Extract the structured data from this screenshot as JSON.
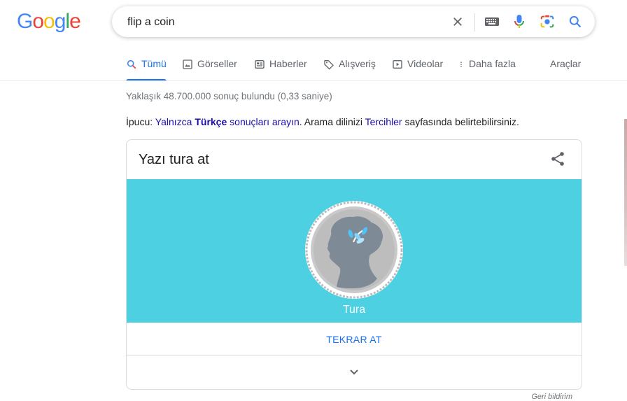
{
  "logo": {
    "letters": [
      "G",
      "o",
      "o",
      "g",
      "l",
      "e"
    ],
    "colors": [
      "#4285f4",
      "#ea4335",
      "#fbbc05",
      "#4285f4",
      "#34a853",
      "#ea4335"
    ]
  },
  "search": {
    "query": "flip a coin",
    "icons": [
      "clear-icon",
      "keyboard-icon",
      "microphone-icon",
      "camera-lens-icon",
      "search-icon"
    ]
  },
  "tabs": [
    {
      "label": "Tümü",
      "icon": "search-icon",
      "active": true
    },
    {
      "label": "Görseller",
      "icon": "image-icon"
    },
    {
      "label": "Haberler",
      "icon": "news-icon"
    },
    {
      "label": "Alışveriş",
      "icon": "tag-icon"
    },
    {
      "label": "Videolar",
      "icon": "play-icon"
    },
    {
      "label": "Daha fazla",
      "icon": "more-vert-icon"
    }
  ],
  "tools_label": "Araçlar",
  "stats": "Yaklaşık 48.700.000 sonuç bulundu (0,33 saniye)",
  "tip": {
    "prefix": "İpucu: ",
    "link1": "Yalnızca",
    "bold": "Türkçe",
    "link2": " sonuçları arayın",
    "middle": ". Arama dilinizi ",
    "link3": "Tercihler",
    "suffix": " sayfasında belirtebilirsiniz."
  },
  "card": {
    "title": "Yazı tura at",
    "result": "Tura",
    "flip_again": "TEKRAR AT",
    "background": "#4dd0e1"
  },
  "feedback": "Geri bildirim",
  "colors": {
    "accent": "#1a73e8",
    "link": "#1a0dab"
  }
}
